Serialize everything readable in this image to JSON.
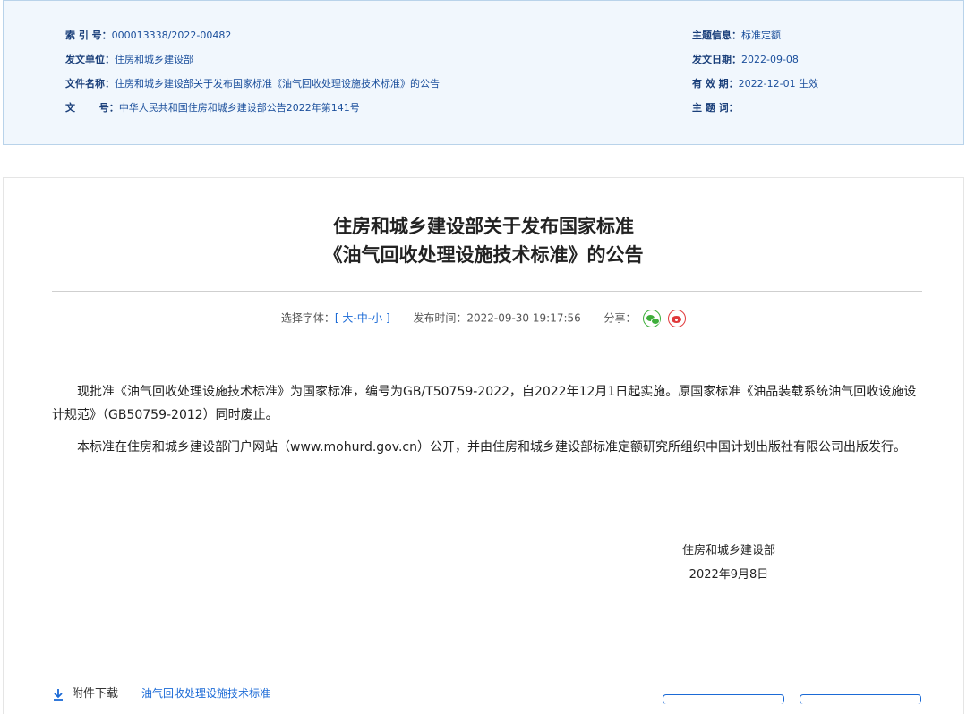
{
  "meta": {
    "index_label": "索 引 号：",
    "index_value": "000013338/2022-00482",
    "issuer_label": "发文单位：",
    "issuer_value": "住房和城乡建设部",
    "filename_label": "文件名称：",
    "filename_value": "住房和城乡建设部关于发布国家标准《油气回收处理设施技术标准》的公告",
    "docno_label": "文       号：",
    "docno_value": "中华人民共和国住房和城乡建设部公告2022年第141号",
    "topic_label": "主题信息：",
    "topic_value": "标准定额",
    "date_label": "发文日期：",
    "date_value": "2022-09-08",
    "validity_label": "有 效 期：",
    "validity_value": "2022-12-01 生效",
    "keywords_label": "主 题 词：",
    "keywords_value": ""
  },
  "article": {
    "title_line1": "住房和城乡建设部关于发布国家标准",
    "title_line2": "《油气回收处理设施技术标准》的公告",
    "font_label": "选择字体：",
    "bracket_open": "[",
    "bracket_close": "]",
    "font_large": "大",
    "font_medium": "中",
    "font_small": "小",
    "dash": "-",
    "publish_label": "发布时间：",
    "publish_time": "2022-09-30 19:17:56",
    "share_label": "分享：",
    "paragraph1": "现批准《油气回收处理设施技术标准》为国家标准，编号为GB/T50759-2022，自2022年12月1日起实施。原国家标准《油品装载系统油气回收设施设计规范》（GB50759-2012）同时废止。",
    "paragraph2": "本标准在住房和城乡建设部门户网站（www.mohurd.gov.cn）公开，并由住房和城乡建设部标准定额研究所组织中国计划出版社有限公司出版发行。",
    "signature": "住房和城乡建设部",
    "sign_date": "2022年9月8日",
    "attachment_label": "附件下载",
    "attachment_link": "油气回收处理设施技术标准"
  },
  "icons": {
    "download": "download-arrow-icon",
    "wechat": "wechat-icon",
    "weibo": "weibo-icon"
  },
  "colors": {
    "accent": "#1b6ad6",
    "meta_bg": "#f1f7fd",
    "label": "#1a3f7a"
  }
}
